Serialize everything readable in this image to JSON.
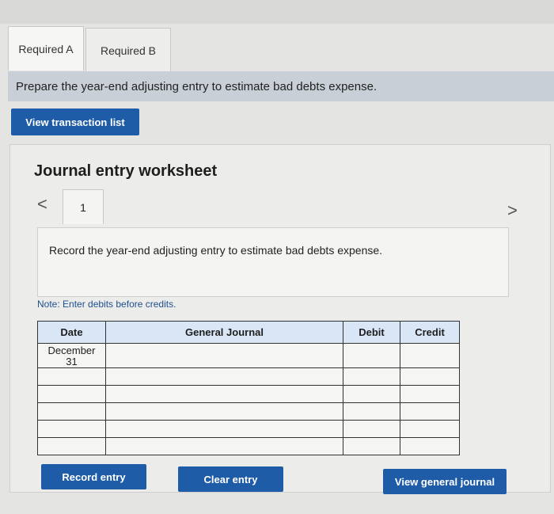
{
  "tabs": [
    {
      "label": "Required A"
    },
    {
      "label": "Required B"
    }
  ],
  "prompt": "Prepare the year-end adjusting entry to estimate bad debts expense.",
  "buttons": {
    "view_transaction_list": "View transaction list",
    "record_entry": "Record entry",
    "clear_entry": "Clear entry",
    "view_general_journal": "View general journal"
  },
  "worksheet": {
    "title": "Journal entry worksheet",
    "entry_tab": "1",
    "nav_prev": "<",
    "nav_next": ">",
    "instruction": "Record the year-end adjusting entry to estimate bad debts expense.",
    "note": "Note: Enter debits before credits."
  },
  "journal": {
    "headers": {
      "date": "Date",
      "general_journal": "General Journal",
      "debit": "Debit",
      "credit": "Credit"
    },
    "first_date_line1": "December",
    "first_date_line2": "31"
  },
  "colors": {
    "button_blue": "#1f5ca8",
    "table_header": "#d9e6f5"
  }
}
